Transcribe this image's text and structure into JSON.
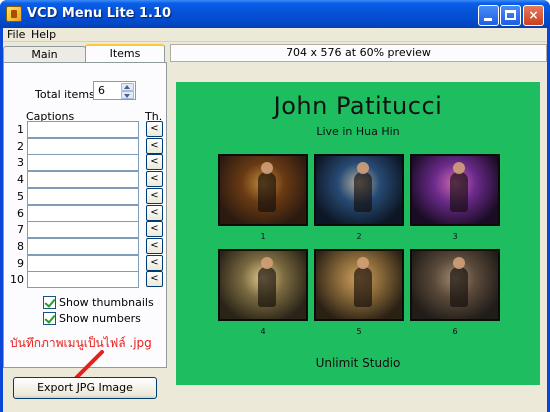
{
  "window": {
    "title": "VCD Menu Lite 1.10",
    "minimize_glyph": "",
    "maximize_glyph": "",
    "close_glyph": "×"
  },
  "menubar": {
    "file": "File",
    "help": "Help"
  },
  "tabs": {
    "main": "Main",
    "items": "Items"
  },
  "items_panel": {
    "total_items_label": "Total items:",
    "total_items_value": "6",
    "captions_header": "Captions",
    "thumbnail_header": "Th.",
    "caption_rows": [
      {
        "number": "1",
        "caption": "",
        "button": "<"
      },
      {
        "number": "2",
        "caption": "",
        "button": "<"
      },
      {
        "number": "3",
        "caption": "",
        "button": "<"
      },
      {
        "number": "4",
        "caption": "",
        "button": "<"
      },
      {
        "number": "5",
        "caption": "",
        "button": "<"
      },
      {
        "number": "6",
        "caption": "",
        "button": "<"
      },
      {
        "number": "7",
        "caption": "",
        "button": "<"
      },
      {
        "number": "8",
        "caption": "",
        "button": "<"
      },
      {
        "number": "9",
        "caption": "",
        "button": "<"
      },
      {
        "number": "10",
        "caption": "",
        "button": "<"
      }
    ],
    "show_thumbnails_label": "Show thumbnails",
    "show_thumbnails_checked": true,
    "show_numbers_label": "Show numbers",
    "show_numbers_checked": true
  },
  "annotation": {
    "thai_note": "บันทึกภาพเมนูเป็นไฟล์ .jpg",
    "arrow_color": "#e8201c"
  },
  "export_button": "Export JPG Image",
  "preview": {
    "header": "704 x 576 at 60% preview",
    "background_color": "#1ebd60",
    "title": "John Patitucci",
    "subtitle": "Live in Hua Hin",
    "thumbnails": [
      {
        "number": "1"
      },
      {
        "number": "2"
      },
      {
        "number": "3"
      },
      {
        "number": "4"
      },
      {
        "number": "5"
      },
      {
        "number": "6"
      }
    ],
    "footer": "Unlimit Studio"
  }
}
